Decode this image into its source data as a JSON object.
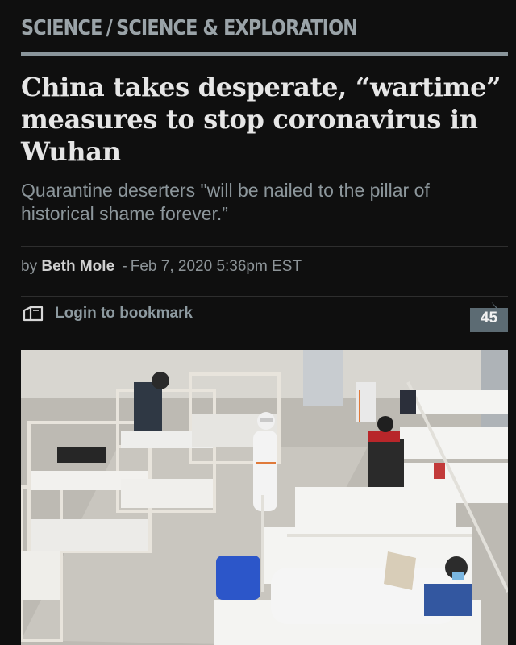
{
  "breadcrumb": {
    "section": "SCIENCE",
    "separator": "/",
    "subsection": "SCIENCE & EXPLORATION"
  },
  "article": {
    "headline": "China takes desperate, “wartime” measures to stop coronavirus in Wuhan",
    "dek": "Quarantine deserters \"will be nailed to the pillar of historical shame forever.”",
    "byline_prefix": "by",
    "author": "Beth Mole",
    "byline_separator": "-",
    "timestamp": "Feb 7, 2020 5:36pm EST"
  },
  "actions": {
    "bookmark_label": "Login to bookmark",
    "bookmark_icon": "bookmark-icon",
    "comment_count": "45",
    "comment_icon": "comment-bubble-icon"
  },
  "colors": {
    "background": "#0f0f0f",
    "rule": "#8a959b",
    "badge": "#5c6b73"
  }
}
